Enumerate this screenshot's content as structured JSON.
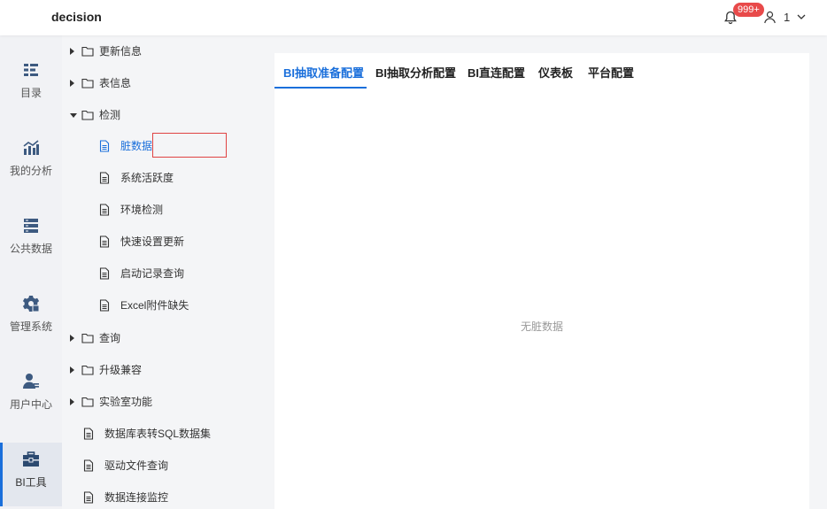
{
  "header": {
    "title": "decision",
    "notification_badge": "999+",
    "user_name": "1"
  },
  "left_nav": [
    {
      "label": "目录",
      "icon": "catalog-icon"
    },
    {
      "label": "我的分析",
      "icon": "analysis-icon"
    },
    {
      "label": "公共数据",
      "icon": "database-icon"
    },
    {
      "label": "管理系统",
      "icon": "settings-gear-icon"
    },
    {
      "label": "用户中心",
      "icon": "user-center-icon"
    },
    {
      "label": "BI工具",
      "icon": "toolbox-icon",
      "active": true
    }
  ],
  "tree": [
    {
      "label": "更新信息",
      "type": "folder",
      "state": "collapsed"
    },
    {
      "label": "表信息",
      "type": "folder",
      "state": "collapsed"
    },
    {
      "label": "检测",
      "type": "folder",
      "state": "expanded"
    },
    {
      "label": "脏数据",
      "type": "file",
      "selected": true
    },
    {
      "label": "系统活跃度",
      "type": "file"
    },
    {
      "label": "环境检测",
      "type": "file"
    },
    {
      "label": "快速设置更新",
      "type": "file"
    },
    {
      "label": "启动记录查询",
      "type": "file"
    },
    {
      "label": "Excel附件缺失",
      "type": "file"
    },
    {
      "label": "查询",
      "type": "folder",
      "state": "collapsed"
    },
    {
      "label": "升级兼容",
      "type": "folder",
      "state": "collapsed"
    },
    {
      "label": "实验室功能",
      "type": "folder",
      "state": "collapsed"
    },
    {
      "label": "数据库表转SQL数据集",
      "type": "file"
    },
    {
      "label": "驱动文件查询",
      "type": "file"
    },
    {
      "label": "数据连接监控",
      "type": "file"
    }
  ],
  "tabs": [
    {
      "label": "BI抽取准备配置",
      "active": true
    },
    {
      "label": "BI抽取分析配置"
    },
    {
      "label": "BI直连配置"
    },
    {
      "label": "仪表板"
    },
    {
      "label": "平台配置"
    }
  ],
  "empty_message": "无脏数据",
  "colors": {
    "accent": "#1a6fdb",
    "badge": "#e84a4a",
    "selection_border": "#e04343"
  }
}
